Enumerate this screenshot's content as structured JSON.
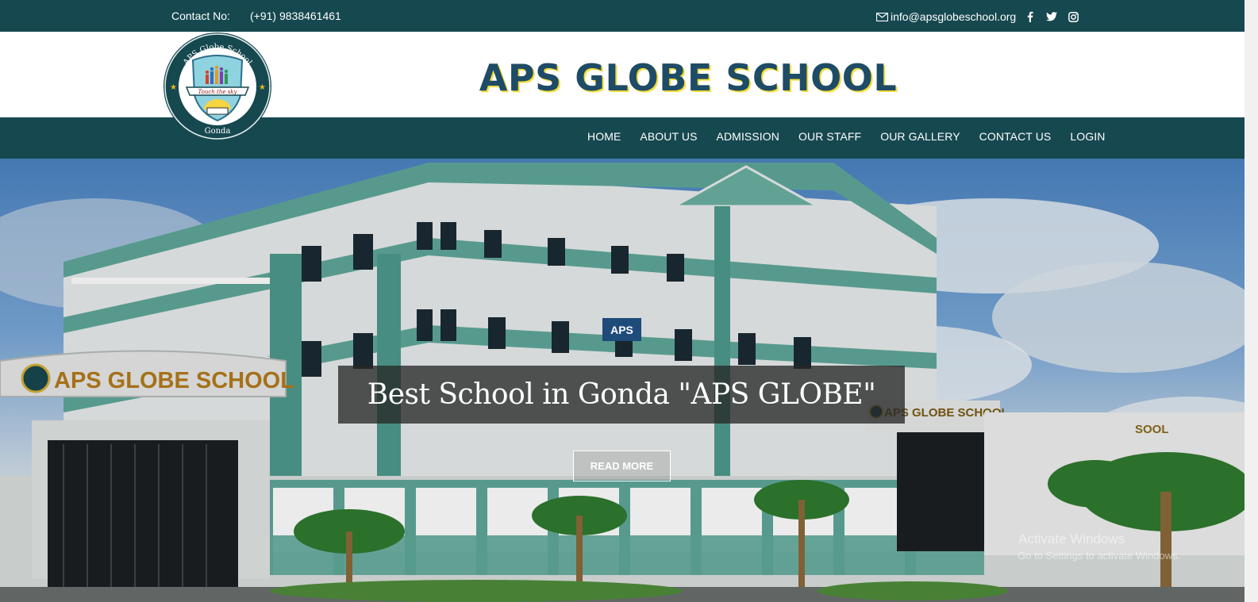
{
  "topbar": {
    "contact_label": "Contact No:",
    "contact_value": "(+91) 9838461461",
    "email": "info@apsglobeschool.org",
    "icons": [
      "mail-icon",
      "facebook-icon",
      "twitter-icon",
      "instagram-icon"
    ]
  },
  "header": {
    "title": "APS GLOBE SCHOOL",
    "logo": {
      "top_text": "APS Globe School",
      "motto": "Touch the sky",
      "bottom_text": "Gonda"
    }
  },
  "nav": {
    "items": [
      "HOME",
      "ABOUT US",
      "ADMISSION",
      "OUR STAFF",
      "OUR GALLERY",
      "CONTACT US",
      "LOGIN"
    ]
  },
  "hero": {
    "badge": "APS",
    "headline": "Best School in Gonda \"APS GLOBE\"",
    "button": "READ MORE",
    "sign_main": "APS GLOBE SCHOOL",
    "sign_right": "APS GLOBE SCHOOL",
    "sign_far": "SOOL",
    "watermark_title": "Activate Windows",
    "watermark_sub": "Go to Settings to activate Windows."
  },
  "colors": {
    "bar": "#16484f",
    "title": "#1e4b66",
    "title_shadow": "#f2dc3b",
    "badge": "#1e4b7a"
  }
}
